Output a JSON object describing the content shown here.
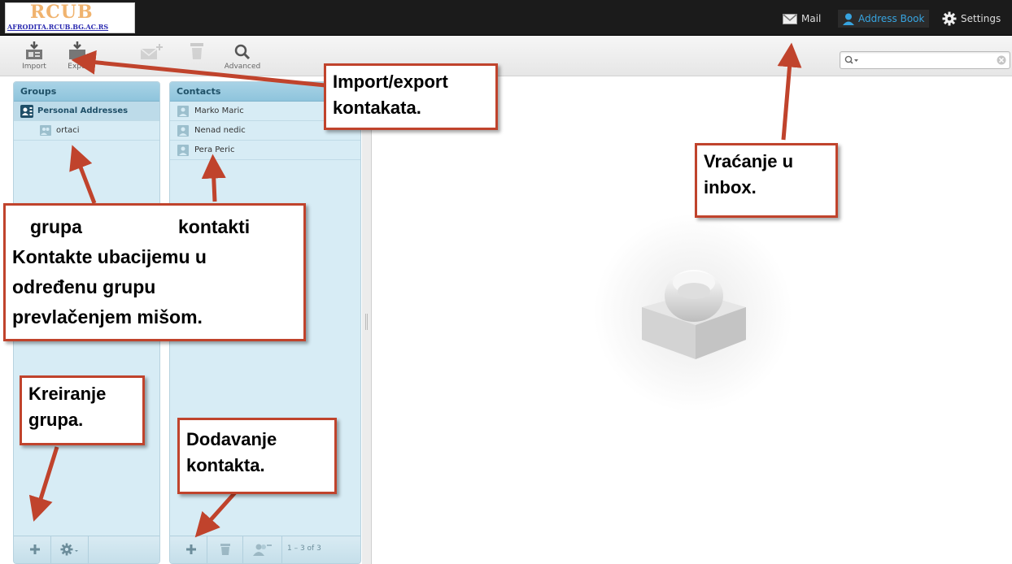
{
  "header": {
    "logo_title": "RCUB",
    "logo_subtitle": "AFRODITA.RCUB.BG.AC.RS",
    "nav": [
      {
        "label": "Mail",
        "icon": "envelope-icon"
      },
      {
        "label": "Address Book",
        "icon": "person-icon",
        "active": true
      },
      {
        "label": "Settings",
        "icon": "gear-icon"
      }
    ]
  },
  "toolbar": {
    "import_label": "Import",
    "export_label": "Export",
    "advanced_label": "Advanced",
    "search_placeholder": ""
  },
  "groups": {
    "title": "Groups",
    "items": [
      {
        "label": "Personal Addresses",
        "selected": true
      },
      {
        "label": "ortaci"
      }
    ]
  },
  "contacts": {
    "title": "Contacts",
    "items": [
      {
        "label": "Marko Maric"
      },
      {
        "label": "Nenad nedic"
      },
      {
        "label": "Pera Peric"
      }
    ],
    "count": "1 – 3 of 3"
  },
  "annotations": {
    "import_export": [
      "Import/export",
      "kontakata."
    ],
    "inbox": [
      "Vraćanje u",
      "inbox."
    ],
    "groups_line1_a": "grupa",
    "groups_line1_b": "kontakti",
    "groups_rest": [
      "Kontakte ubacijemu u",
      "određenu grupu",
      "prevlačenjem mišom."
    ],
    "create_groups": [
      "Kreiranje",
      "grupa."
    ],
    "add_contact": [
      "Dodavanje",
      "kontakta."
    ]
  },
  "colors": {
    "accent": "#37a4e0",
    "annotation_border": "#c0432c",
    "panel_bg": "#d7ecf5"
  }
}
